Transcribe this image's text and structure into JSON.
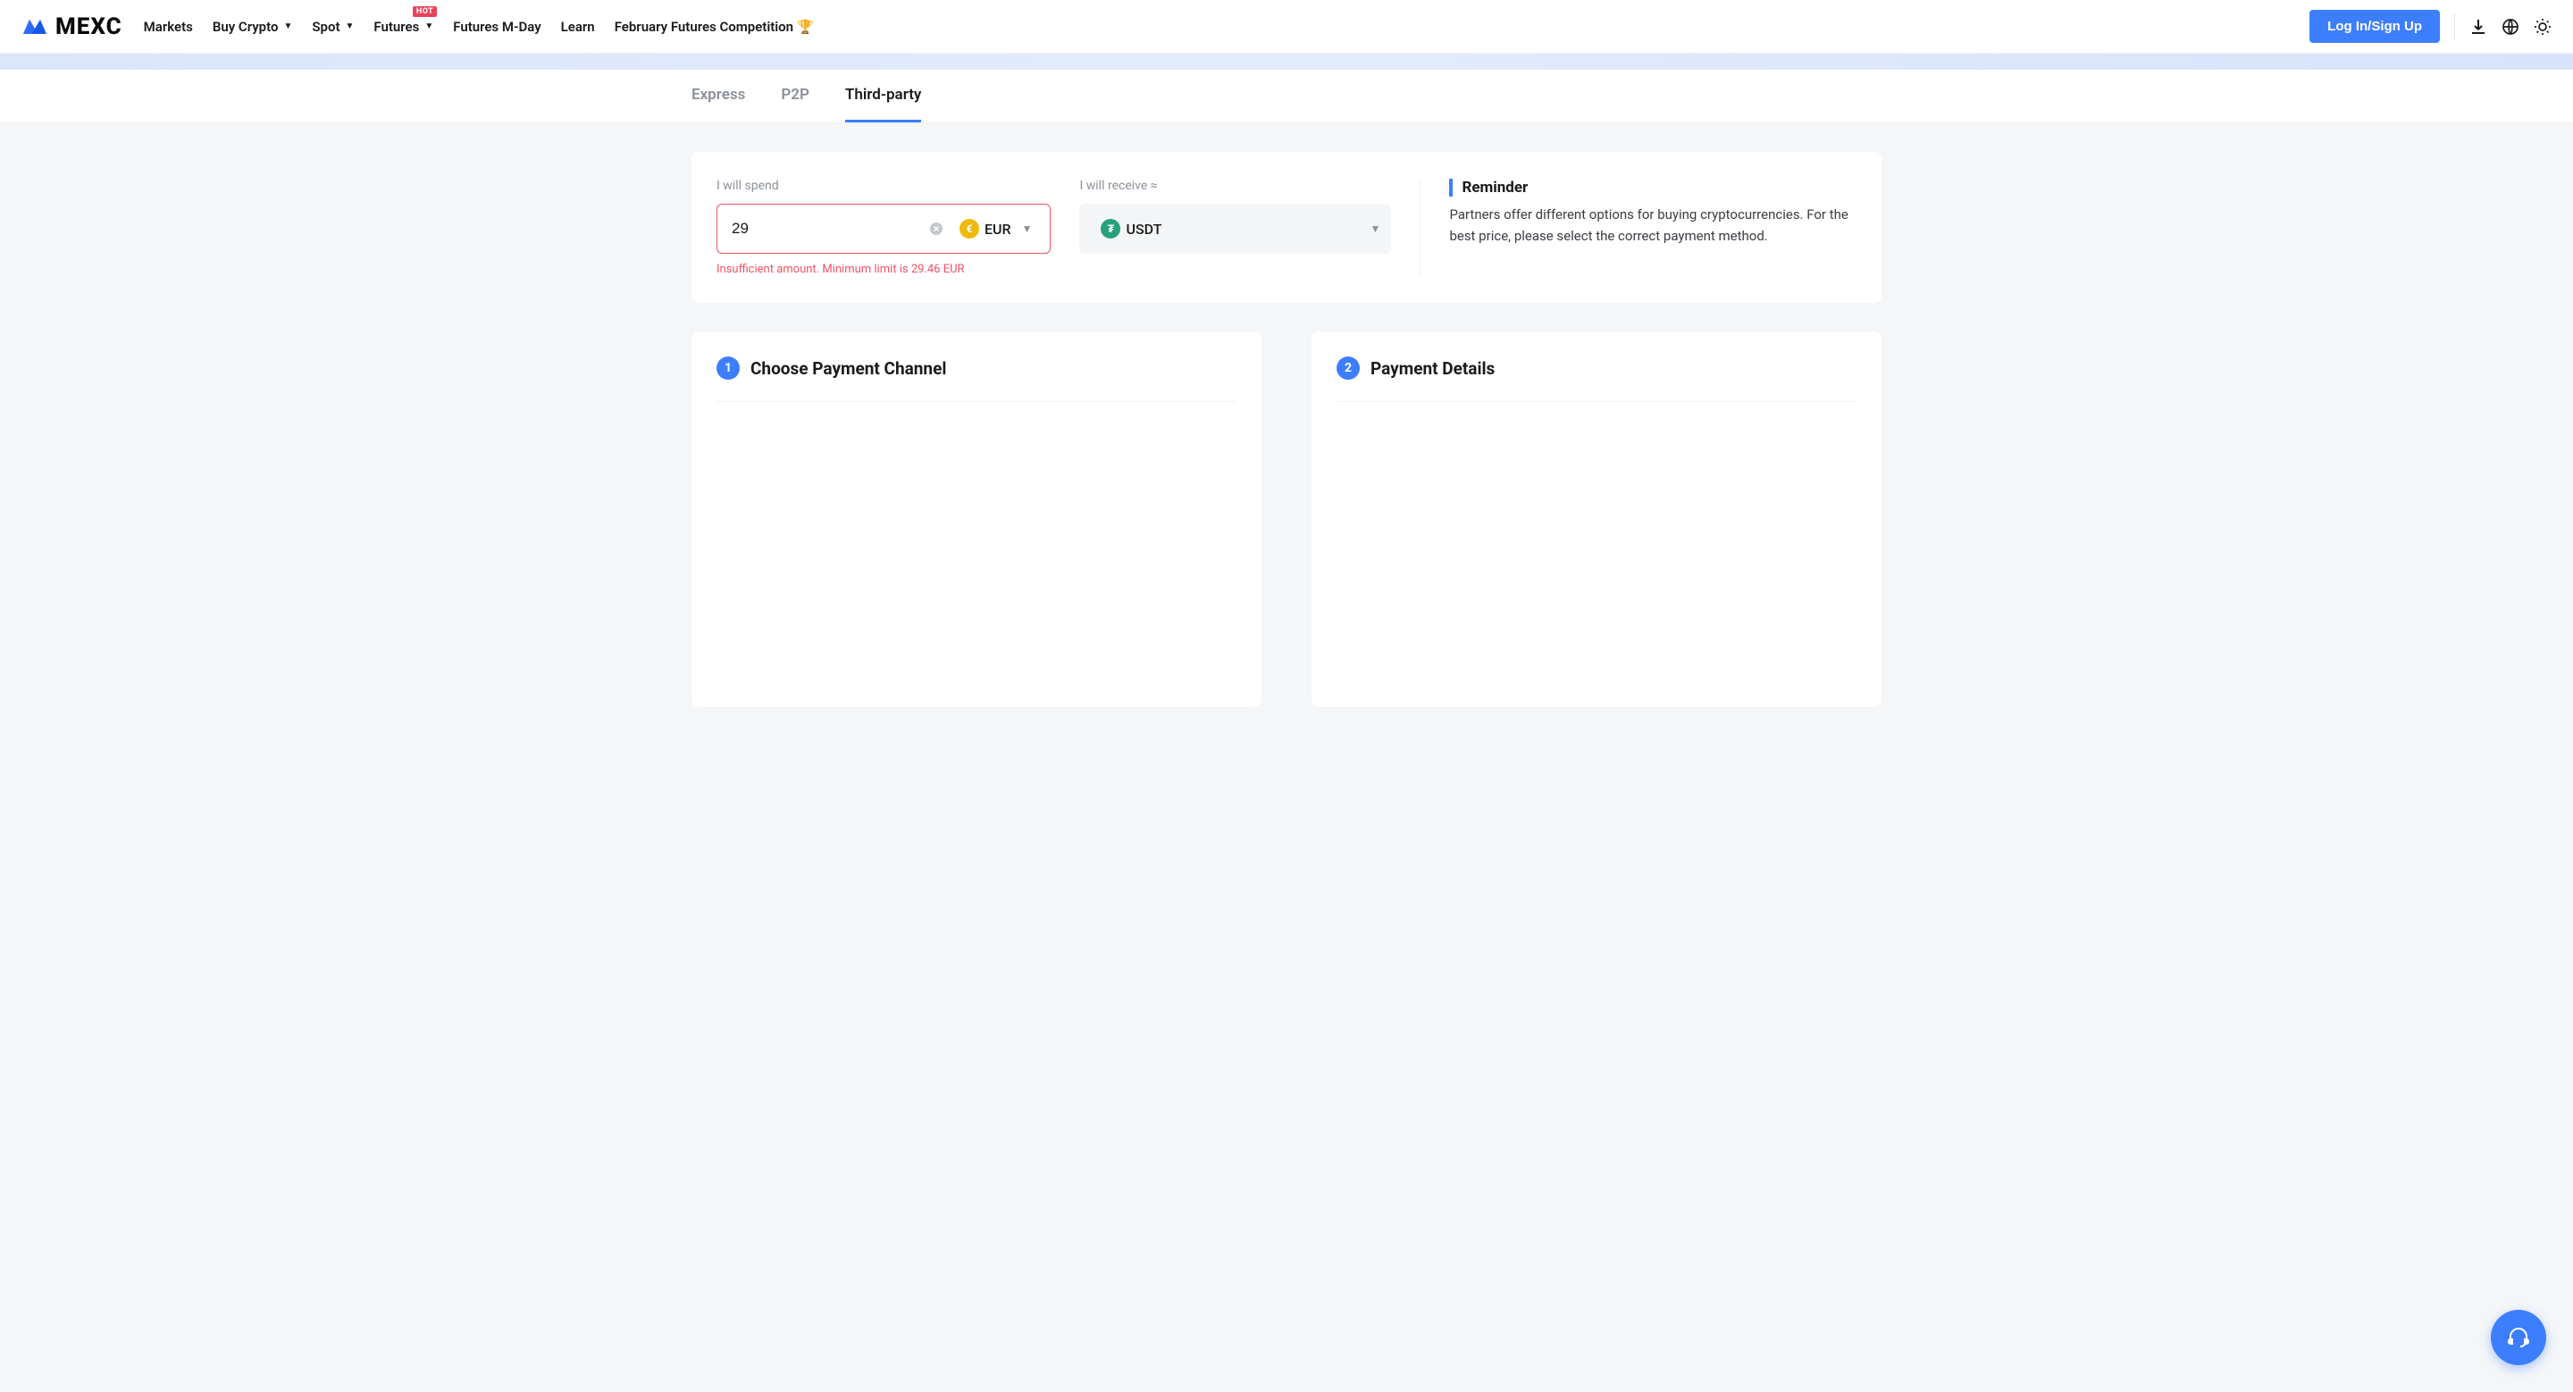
{
  "header": {
    "brand": "MEXC",
    "nav": [
      {
        "label": "Markets"
      },
      {
        "label": "Buy Crypto",
        "dropdown": true
      },
      {
        "label": "Spot",
        "dropdown": true
      },
      {
        "label": "Futures",
        "dropdown": true,
        "badge": "HOT"
      },
      {
        "label": "Futures M-Day"
      },
      {
        "label": "Learn"
      },
      {
        "label": "February Futures Competition",
        "trophy": true
      }
    ],
    "login_label": "Log In/Sign Up"
  },
  "subnav": {
    "items": [
      {
        "label": "Express"
      },
      {
        "label": "P2P"
      },
      {
        "label": "Third-party",
        "active": true
      }
    ]
  },
  "form": {
    "spend": {
      "label": "I will spend",
      "value": "29",
      "currency": "EUR",
      "error": "Insufficient amount. Minimum limit is 29.46 EUR"
    },
    "receive": {
      "label": "I will receive ≈",
      "currency": "USDT"
    }
  },
  "reminder": {
    "title": "Reminder",
    "text": "Partners offer different options for buying cryptocurrencies. For the best price, please select the correct payment method."
  },
  "panels": {
    "left": {
      "step": "1",
      "title": "Choose Payment Channel"
    },
    "right": {
      "step": "2",
      "title": "Payment Details"
    }
  }
}
